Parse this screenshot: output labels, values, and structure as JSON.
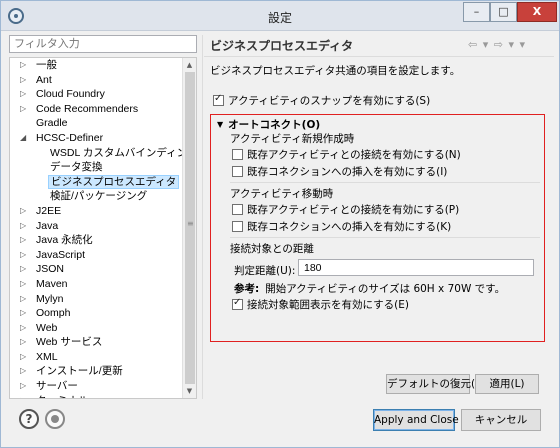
{
  "window": {
    "title": "設定",
    "min": "–",
    "max": "□",
    "close": "X"
  },
  "filter": {
    "placeholder": "フィルタ入力"
  },
  "tree": [
    {
      "label": "一般",
      "arrow": "▷",
      "level": 0
    },
    {
      "label": "Ant",
      "arrow": "▷",
      "level": 0
    },
    {
      "label": "Cloud Foundry",
      "arrow": "▷",
      "level": 0
    },
    {
      "label": "Code Recommenders",
      "arrow": "▷",
      "level": 0
    },
    {
      "label": "Gradle",
      "arrow": "",
      "level": 0
    },
    {
      "label": "HCSC-Definer",
      "arrow": "◢",
      "level": 0
    },
    {
      "label": "WSDL カスタムバインディング",
      "arrow": "",
      "level": 1
    },
    {
      "label": "データ変換",
      "arrow": "",
      "level": 1
    },
    {
      "label": "ビジネスプロセスエディタ",
      "arrow": "",
      "level": 1,
      "selected": true
    },
    {
      "label": "検証/パッケージング",
      "arrow": "",
      "level": 1
    },
    {
      "label": "J2EE",
      "arrow": "▷",
      "level": 0
    },
    {
      "label": "Java",
      "arrow": "▷",
      "level": 0
    },
    {
      "label": "Java 永続化",
      "arrow": "▷",
      "level": 0
    },
    {
      "label": "JavaScript",
      "arrow": "▷",
      "level": 0
    },
    {
      "label": "JSON",
      "arrow": "▷",
      "level": 0
    },
    {
      "label": "Maven",
      "arrow": "▷",
      "level": 0
    },
    {
      "label": "Mylyn",
      "arrow": "▷",
      "level": 0
    },
    {
      "label": "Oomph",
      "arrow": "▷",
      "level": 0
    },
    {
      "label": "Web",
      "arrow": "▷",
      "level": 0
    },
    {
      "label": "Web サービス",
      "arrow": "▷",
      "level": 0
    },
    {
      "label": "XML",
      "arrow": "▷",
      "level": 0
    },
    {
      "label": "インストール/更新",
      "arrow": "▷",
      "level": 0
    },
    {
      "label": "サーバー",
      "arrow": "▷",
      "level": 0
    },
    {
      "label": "ターミナル",
      "arrow": "▷",
      "level": 0
    }
  ],
  "page": {
    "title": "ビジネスプロセスエディタ",
    "nav": "⇦ ▾ ⇨ ▾ ▾",
    "description": "ビジネスプロセスエディタ共通の項目を設定します。",
    "snap_checkbox": {
      "label": "アクティビティのスナップを有効にする(S)",
      "checked": true
    },
    "autoconnect": {
      "title": "オートコネクト(O)",
      "new_section": "アクティビティ新規作成時",
      "new_items": [
        {
          "label": "既存アクティビティとの接続を有効にする(N)",
          "checked": false
        },
        {
          "label": "既存コネクションへの挿入を有効にする(I)",
          "checked": false
        }
      ],
      "move_section": "アクティビティ移動時",
      "move_items": [
        {
          "label": "既存アクティビティとの接続を有効にする(P)",
          "checked": false
        },
        {
          "label": "既存コネクションへの挿入を有効にする(K)",
          "checked": false
        }
      ],
      "distance_section": "接続対象との距離",
      "distance_label": "判定距離(U):",
      "distance_value": "180",
      "note_label": "参考:",
      "note_text": "開始アクティビティのサイズは 60H x 70W です。",
      "range_checkbox": {
        "label": "接続対象範囲表示を有効にする(E)",
        "checked": true
      }
    },
    "restore_defaults": "デフォルトの復元(T)",
    "apply": "適用(L)"
  },
  "footer": {
    "help": "?",
    "apply_close": "Apply and Close",
    "cancel": "キャンセル"
  }
}
